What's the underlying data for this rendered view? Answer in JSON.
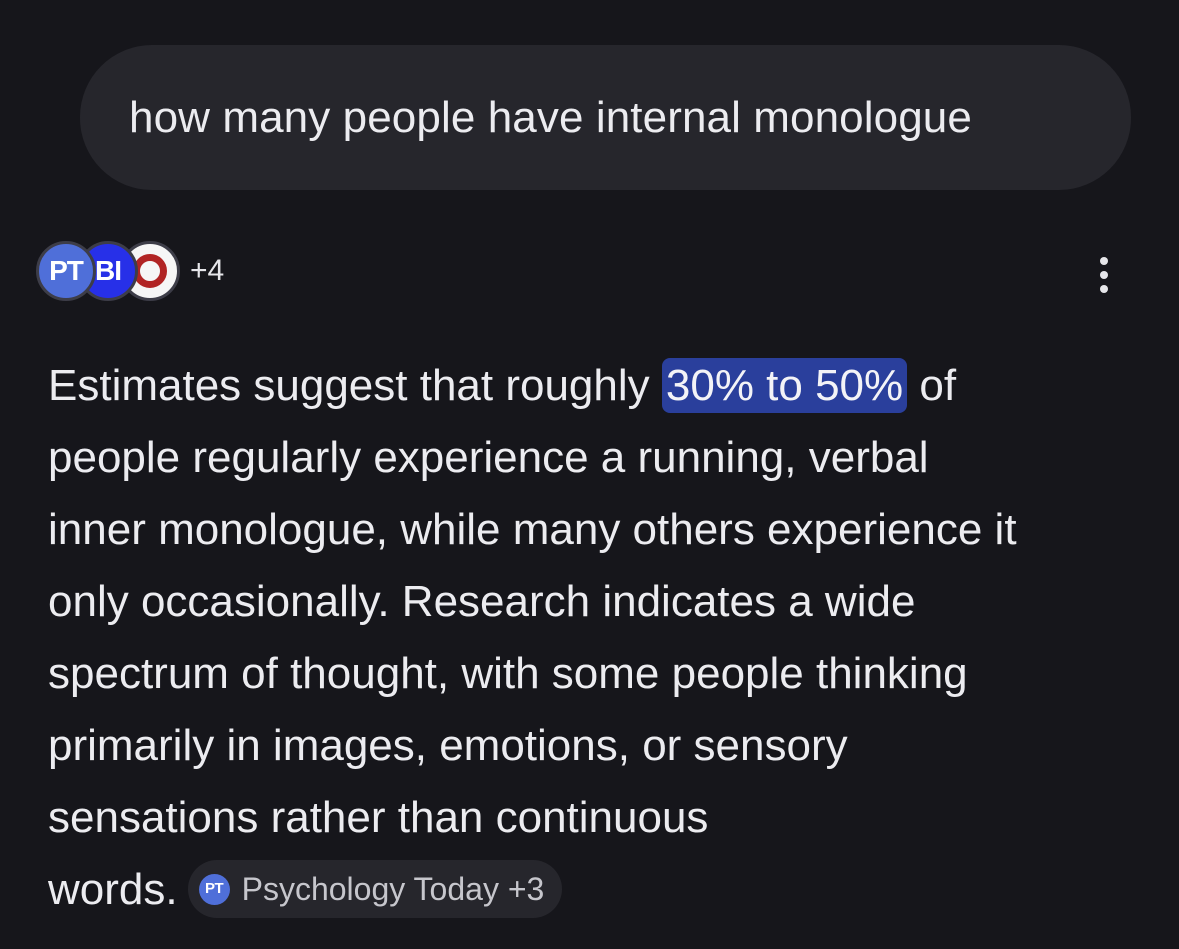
{
  "query": {
    "text": "how many people have internal monologue"
  },
  "sources": {
    "avatars": [
      {
        "label": "PT",
        "icon": "psychology-today-icon",
        "color": "#4f6fd9"
      },
      {
        "label": "BI",
        "icon": "business-insider-icon",
        "color": "#2730e8"
      },
      {
        "label": "",
        "icon": "ring-logo-icon",
        "color": "#b12424"
      }
    ],
    "more_count": "+4"
  },
  "answer": {
    "line1_before": "Estimates suggest that roughly ",
    "highlight": "30% to 50%",
    "line1_after": " of",
    "line2": "people regularly experience a running, verbal",
    "line3": "inner monologue, while many others experience it",
    "line4": "only occasionally. Research indicates a wide",
    "line5": "spectrum of thought, with some people thinking",
    "line6": "primarily in images, emotions, or sensory",
    "line7": "sensations rather than continuous",
    "line8": "words."
  },
  "citation": {
    "icon_label": "PT",
    "label": "Psychology Today +3"
  },
  "colors": {
    "background": "#16161b",
    "bubble": "#26262c",
    "highlight": "#2a3f9c",
    "text": "#ececf0"
  }
}
